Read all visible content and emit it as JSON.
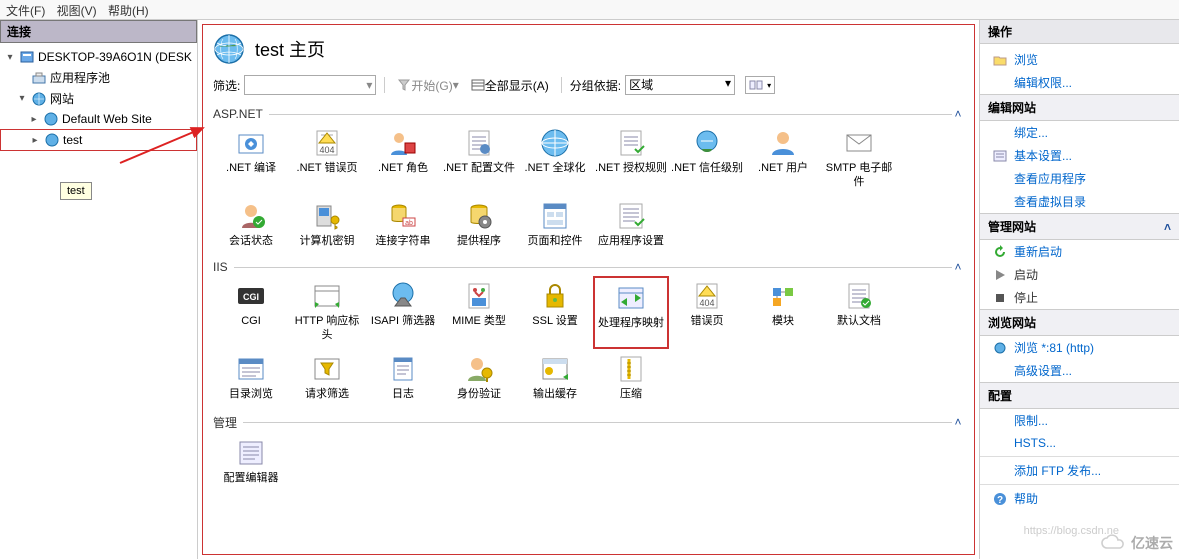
{
  "topmenu": {
    "file": "文件(F)",
    "view": "视图(V)",
    "help": "帮助(H)"
  },
  "tree": {
    "header": "连接",
    "root": "DESKTOP-39A6O1N (DESK",
    "apppools": "应用程序池",
    "sites": "网站",
    "default_site": "Default Web Site",
    "test_site": "test",
    "tooltip": "test"
  },
  "page": {
    "title": "test 主页"
  },
  "filter": {
    "label": "筛选:",
    "go": "开始(G)",
    "showall": "全部显示(A)",
    "groupby_label": "分组依据:",
    "groupby_value": "区域"
  },
  "groups": {
    "aspnet": {
      "title": "ASP.NET",
      "items": [
        {
          "name": "net-compile",
          "label": ".NET 编译"
        },
        {
          "name": "net-error-pages",
          "label": ".NET 错误页"
        },
        {
          "name": "net-roles",
          "label": ".NET 角色"
        },
        {
          "name": "net-profiles",
          "label": ".NET 配置文件"
        },
        {
          "name": "net-globalization",
          "label": ".NET 全球化"
        },
        {
          "name": "net-authorization",
          "label": ".NET 授权规则"
        },
        {
          "name": "net-trust",
          "label": ".NET 信任级别"
        },
        {
          "name": "net-users",
          "label": ".NET 用户"
        },
        {
          "name": "smtp-email",
          "label": "SMTP 电子邮件"
        },
        {
          "name": "session-state",
          "label": "会话状态"
        },
        {
          "name": "machine-key",
          "label": "计算机密钥"
        },
        {
          "name": "connection-strings",
          "label": "连接字符串"
        },
        {
          "name": "providers",
          "label": "提供程序"
        },
        {
          "name": "pages-controls",
          "label": "页面和控件"
        },
        {
          "name": "app-settings",
          "label": "应用程序设置"
        }
      ]
    },
    "iis": {
      "title": "IIS",
      "items": [
        {
          "name": "cgi",
          "label": "CGI"
        },
        {
          "name": "http-response-headers",
          "label": "HTTP 响应标头"
        },
        {
          "name": "isapi-filters",
          "label": "ISAPI 筛选器"
        },
        {
          "name": "mime-types",
          "label": "MIME 类型"
        },
        {
          "name": "ssl-settings",
          "label": "SSL 设置"
        },
        {
          "name": "handler-mappings",
          "label": "处理程序映射",
          "highlight": true
        },
        {
          "name": "error-pages",
          "label": "错误页"
        },
        {
          "name": "modules",
          "label": "模块"
        },
        {
          "name": "default-document",
          "label": "默认文档"
        },
        {
          "name": "directory-browsing",
          "label": "目录浏览"
        },
        {
          "name": "request-filtering",
          "label": "请求筛选"
        },
        {
          "name": "logging",
          "label": "日志"
        },
        {
          "name": "authentication",
          "label": "身份验证"
        },
        {
          "name": "output-caching",
          "label": "输出缓存"
        },
        {
          "name": "compression",
          "label": "压缩"
        }
      ]
    },
    "management": {
      "title": "管理",
      "items": [
        {
          "name": "config-editor",
          "label": "配置编辑器"
        }
      ]
    }
  },
  "actions": {
    "header": "操作",
    "browse": "浏览",
    "edit_perms": "编辑权限...",
    "edit_site": "编辑网站",
    "bindings": "绑定...",
    "basic": "基本设置...",
    "view_apps": "查看应用程序",
    "view_vdirs": "查看虚拟目录",
    "manage_site": "管理网站",
    "restart": "重新启动",
    "start": "启动",
    "stop": "停止",
    "browse_site": "浏览网站",
    "browse_81": "浏览 *:81 (http)",
    "advanced": "高级设置...",
    "config": "配置",
    "limits": "限制...",
    "hsts": "HSTS...",
    "add_ftp": "添加 FTP 发布...",
    "help": "帮助"
  },
  "watermark": {
    "brand": "亿速云",
    "url": "https://blog.csdn.ne"
  }
}
